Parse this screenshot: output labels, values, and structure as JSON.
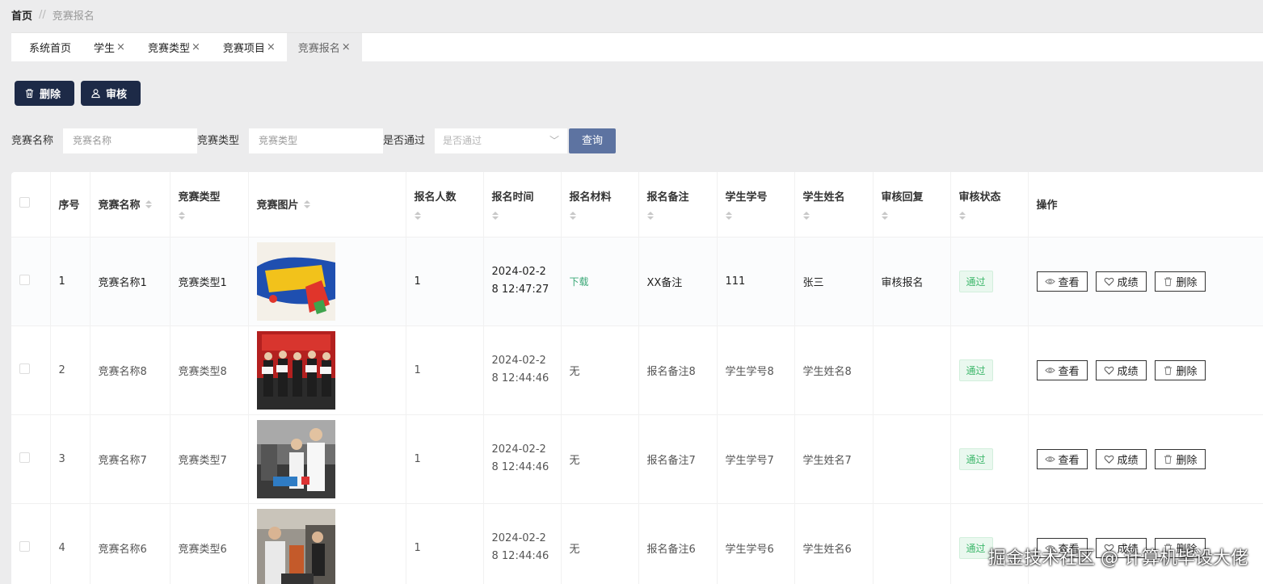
{
  "breadcrumb": {
    "home": "首页",
    "separator": "//",
    "current": "竞赛报名"
  },
  "tabs": [
    {
      "label": "系统首页",
      "closable": false
    },
    {
      "label": "学生",
      "closable": true
    },
    {
      "label": "竞赛类型",
      "closable": true
    },
    {
      "label": "竞赛项目",
      "closable": true
    },
    {
      "label": "竞赛报名",
      "closable": true,
      "active": true
    }
  ],
  "tab_close_glyph": "×",
  "toolbar": {
    "delete_label": "删除",
    "review_label": "审核"
  },
  "search": {
    "name_label": "竞赛名称",
    "name_placeholder": "竞赛名称",
    "type_label": "竞赛类型",
    "type_placeholder": "竞赛类型",
    "pass_label": "是否通过",
    "pass_placeholder": "是否通过",
    "query_label": "查询"
  },
  "table": {
    "headers": {
      "index": "序号",
      "name": "竞赛名称",
      "type": "竞赛类型",
      "image": "竞赛图片",
      "count": "报名人数",
      "time": "报名时间",
      "material": "报名材料",
      "remark": "报名备注",
      "student_no": "学生学号",
      "student_name": "学生姓名",
      "reply": "审核回复",
      "status": "审核状态",
      "ops": "操作"
    },
    "op_labels": {
      "view": "查看",
      "score": "成绩",
      "delete": "删除"
    },
    "rows": [
      {
        "index": "1",
        "name": "竞赛名称1",
        "type": "竞赛类型1",
        "image": "poster",
        "count": "1",
        "time_line1": "2024-02-2",
        "time_line2": "8 12:47:27",
        "material": "下载",
        "material_is_link": true,
        "remark": "XX备注",
        "student_no": "111",
        "student_name": "张三",
        "reply": "审核报名",
        "status": "通过"
      },
      {
        "index": "2",
        "name": "竞赛名称8",
        "type": "竞赛类型8",
        "image": "ceremony",
        "count": "1",
        "time_line1": "2024-02-2",
        "time_line2": "8 12:44:46",
        "material": "无",
        "material_is_link": false,
        "remark": "报名备注8",
        "student_no": "学生学号8",
        "student_name": "学生姓名8",
        "reply": "",
        "status": "通过"
      },
      {
        "index": "3",
        "name": "竞赛名称7",
        "type": "竞赛类型7",
        "image": "lab",
        "count": "1",
        "time_line1": "2024-02-2",
        "time_line2": "8 12:44:46",
        "material": "无",
        "material_is_link": false,
        "remark": "报名备注7",
        "student_no": "学生学号7",
        "student_name": "学生姓名7",
        "reply": "",
        "status": "通过"
      },
      {
        "index": "4",
        "name": "竞赛名称6",
        "type": "竞赛类型6",
        "image": "workshop",
        "count": "1",
        "time_line1": "2024-02-2",
        "time_line2": "8 12:44:46",
        "material": "无",
        "material_is_link": false,
        "remark": "报名备注6",
        "student_no": "学生学号6",
        "student_name": "学生姓名6",
        "reply": "",
        "status": "通过"
      }
    ]
  },
  "watermark": "掘金技术社区 @ 计算机毕设大佬",
  "colors": {
    "primary_dark": "#1d2a47",
    "query_button": "#5d73a1",
    "pass_green": "#3cb76a",
    "link_green": "#3aa776"
  }
}
